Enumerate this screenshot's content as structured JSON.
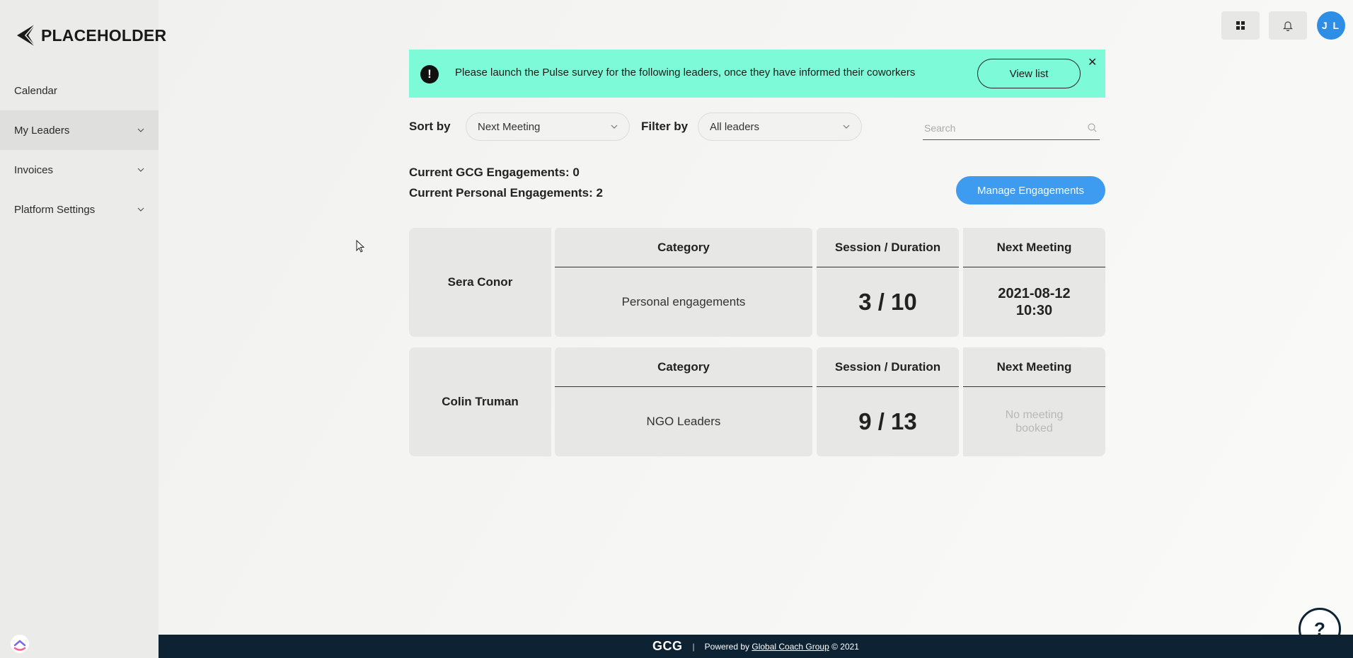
{
  "brand": {
    "logo_text": "PLACEHOLDER"
  },
  "sidebar": {
    "items": [
      {
        "label": "Calendar",
        "has_chevron": false
      },
      {
        "label": "My Leaders",
        "has_chevron": true,
        "active": true
      },
      {
        "label": "Invoices",
        "has_chevron": true
      },
      {
        "label": "Platform Settings",
        "has_chevron": true
      }
    ]
  },
  "header": {
    "avatar_initials": "J L"
  },
  "banner": {
    "message": "Please launch the Pulse survey for the following leaders, once they have informed their coworkers",
    "button_label": "View list",
    "close_glyph": "✕",
    "icon_glyph": "!"
  },
  "filters": {
    "sort_label": "Sort by",
    "sort_value": "Next Meeting",
    "filter_label": "Filter by",
    "filter_value": "All leaders",
    "search_placeholder": "Search"
  },
  "stats": {
    "gcg": "Current GCG Engagements: 0",
    "personal": "Current Personal Engagements: 2"
  },
  "manage_button": "Manage Engagements",
  "columns": {
    "category": "Category",
    "session": "Session / Duration",
    "next_meeting": "Next Meeting"
  },
  "leaders": [
    {
      "name": "Sera Conor",
      "category": "Personal engagements",
      "session": "3 / 10",
      "meeting_date": "2021-08-12",
      "meeting_time": "10:30"
    },
    {
      "name": "Colin Truman",
      "category": "NGO Leaders",
      "session": "9 / 13",
      "meeting_none": "No meeting booked"
    }
  ],
  "footer": {
    "logo": "GCG",
    "separator": "|",
    "powered_by": "Powered by",
    "link": "Global Coach Group",
    "copyright": "© 2021"
  },
  "help": {
    "glyph": "?"
  },
  "colors": {
    "accent": "#3d9bf0",
    "banner": "#7dfbd9",
    "footer": "#0d2233",
    "avatar": "#2e8ee6"
  }
}
